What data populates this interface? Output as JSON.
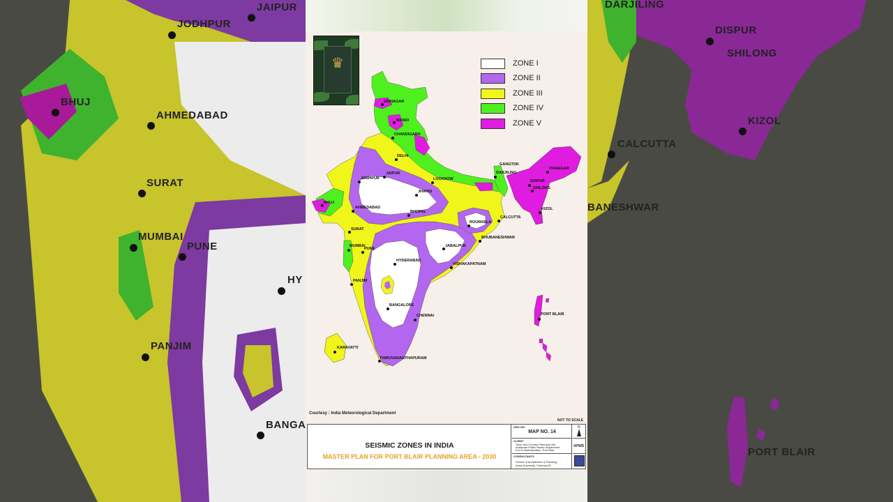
{
  "legend": [
    {
      "label": "ZONE I",
      "color": "#ffffff"
    },
    {
      "label": "ZONE II",
      "color": "#b366f0"
    },
    {
      "label": "ZONE III",
      "color": "#f0f51a"
    },
    {
      "label": "ZONE IV",
      "color": "#4ef01e"
    },
    {
      "label": "ZONE V",
      "color": "#e01ce0"
    }
  ],
  "cities": [
    {
      "name": "SRINAGAR"
    },
    {
      "name": "MANDI"
    },
    {
      "name": "CHANDIGARH"
    },
    {
      "name": "DELHI"
    },
    {
      "name": "JAIPUR"
    },
    {
      "name": "JODHPUR"
    },
    {
      "name": "LUCKNOW"
    },
    {
      "name": "JHANSI"
    },
    {
      "name": "BHUJ"
    },
    {
      "name": "AHMEDABAD"
    },
    {
      "name": "BHOPAL"
    },
    {
      "name": "SURAT"
    },
    {
      "name": "MUMBAI"
    },
    {
      "name": "PUNE"
    },
    {
      "name": "JABALPUR"
    },
    {
      "name": "ROURKELA"
    },
    {
      "name": "BHUBANESHWAR"
    },
    {
      "name": "CALCUTTA"
    },
    {
      "name": "HYDERABAD"
    },
    {
      "name": "VISHAKAPATNAM"
    },
    {
      "name": "PANJIM"
    },
    {
      "name": "BANGALORE"
    },
    {
      "name": "CHENNAI"
    },
    {
      "name": "KARAVATTI"
    },
    {
      "name": "THIRUVANANTHAPURAM"
    },
    {
      "name": "GANGTOK"
    },
    {
      "name": "DARJILING"
    },
    {
      "name": "ITANAGAR"
    },
    {
      "name": "DISPUR"
    },
    {
      "name": "SHILONG"
    },
    {
      "name": "KIZOL"
    },
    {
      "name": "PORT BLAIR"
    }
  ],
  "bg_left_labels": [
    "JAIPUR",
    "JODHPUR",
    "BHUJ",
    "AHMEDABAD",
    "SURAT",
    "MUMBAI",
    "PUNE",
    "HY",
    "PANJIM",
    "BANGA"
  ],
  "bg_right_labels": [
    "DARJILING",
    "DISPUR",
    "SHILONG",
    "KIZOL",
    "CALCUTTA",
    "BANESHWAR",
    "PORT BLAIR"
  ],
  "courtesy": "Courtesy : India Meteorological Department",
  "not_to_scale": "NOT TO SCALE",
  "north": "N",
  "title_block": {
    "title": "SEISMIC ZONES IN INDIA",
    "subtitle": "MASTER PLAN FOR PORT BLAIR PLANNING AREA - 2030",
    "drg_no_label": "DRG NO.",
    "map_no": "MAP NO. 14",
    "client_label": "CLIENT",
    "client_lines": [
      "Town and Country Planning Unit",
      "Andaman Public Works Department",
      "A & N Administration, Port Blair"
    ],
    "client_logo": "APWD",
    "consultants_label": "CONSULTANTS",
    "consultant_lines": [
      "School of Architecture & Planning",
      "Anna University, Chennai-25"
    ]
  }
}
